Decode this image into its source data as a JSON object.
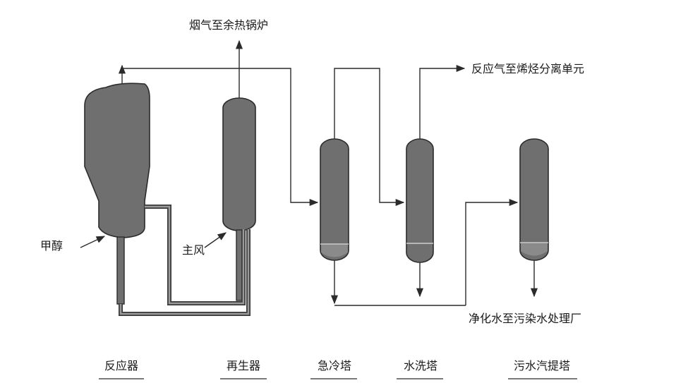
{
  "labels": {
    "flue_gas": "烟气至余热锅炉",
    "reaction_gas": "反应气至烯烃分离单元",
    "methanol": "甲醇",
    "main_air": "主风",
    "clean_water": "净化水至污染水处理厂"
  },
  "captions": {
    "reactor": "反应器",
    "regenerator": "再生器",
    "quench_tower": "急冷塔",
    "water_wash_tower": "水洗塔",
    "stripper": "污水汽提塔"
  },
  "colors": {
    "vessel_fill": "#6f6f6f",
    "line": "#2b2b2b",
    "background": "#ffffff"
  }
}
